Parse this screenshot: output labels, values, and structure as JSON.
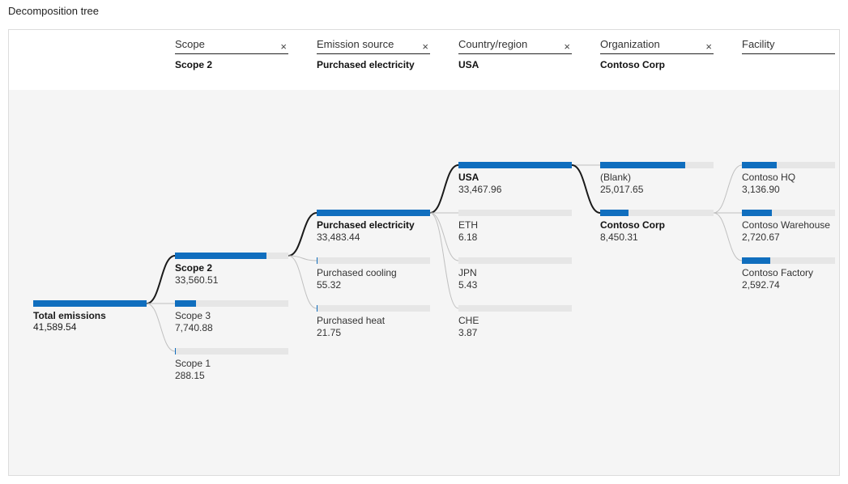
{
  "title": "Decomposition tree",
  "columns": [
    {
      "label": "Scope",
      "selected": "Scope 2",
      "closable": true
    },
    {
      "label": "Emission source",
      "selected": "Purchased electricity",
      "closable": true
    },
    {
      "label": "Country/region",
      "selected": "USA",
      "closable": true
    },
    {
      "label": "Organization",
      "selected": "Contoso Corp",
      "closable": true
    },
    {
      "label": "Facility",
      "selected": "",
      "closable": false
    }
  ],
  "root": {
    "name": "Total emissions",
    "value": "41,589.54"
  },
  "levels": {
    "scope": {
      "max": 41589.54,
      "nodes": [
        {
          "name": "Scope 2",
          "value": "33,560.51",
          "num": 33560.51,
          "selected": true
        },
        {
          "name": "Scope 3",
          "value": "7,740.88",
          "num": 7740.88,
          "selected": false
        },
        {
          "name": "Scope 1",
          "value": "288.15",
          "num": 288.15,
          "selected": false
        }
      ]
    },
    "source": {
      "max": 33560.51,
      "nodes": [
        {
          "name": "Purchased electricity",
          "value": "33,483.44",
          "num": 33483.44,
          "selected": true
        },
        {
          "name": "Purchased cooling",
          "value": "55.32",
          "num": 55.32,
          "selected": false
        },
        {
          "name": "Purchased heat",
          "value": "21.75",
          "num": 21.75,
          "selected": false
        }
      ]
    },
    "country": {
      "max": 33483.44,
      "nodes": [
        {
          "name": "USA",
          "value": "33,467.96",
          "num": 33467.96,
          "selected": true
        },
        {
          "name": "ETH",
          "value": "6.18",
          "num": 6.18,
          "selected": false
        },
        {
          "name": "JPN",
          "value": "5.43",
          "num": 5.43,
          "selected": false
        },
        {
          "name": "CHE",
          "value": "3.87",
          "num": 3.87,
          "selected": false
        }
      ]
    },
    "org": {
      "max": 33467.96,
      "nodes": [
        {
          "name": "(Blank)",
          "value": "25,017.65",
          "num": 25017.65,
          "selected": false
        },
        {
          "name": "Contoso Corp",
          "value": "8,450.31",
          "num": 8450.31,
          "selected": true
        }
      ]
    },
    "facility": {
      "max": 8450.31,
      "nodes": [
        {
          "name": "Contoso HQ",
          "value": "3,136.90",
          "num": 3136.9,
          "selected": false
        },
        {
          "name": "Contoso Warehouse",
          "value": "2,720.67",
          "num": 2720.67,
          "selected": false
        },
        {
          "name": "Contoso Factory",
          "value": "2,592.74",
          "num": 2592.74,
          "selected": false
        }
      ]
    }
  },
  "chart_data": {
    "type": "tree",
    "title": "Decomposition tree",
    "root": {
      "name": "Total emissions",
      "value": 41589.54
    },
    "levels": [
      {
        "dimension": "Scope",
        "selected": "Scope 2",
        "nodes": [
          {
            "name": "Scope 2",
            "value": 33560.51
          },
          {
            "name": "Scope 3",
            "value": 7740.88
          },
          {
            "name": "Scope 1",
            "value": 288.15
          }
        ]
      },
      {
        "dimension": "Emission source",
        "selected": "Purchased electricity",
        "nodes": [
          {
            "name": "Purchased electricity",
            "value": 33483.44
          },
          {
            "name": "Purchased cooling",
            "value": 55.32
          },
          {
            "name": "Purchased heat",
            "value": 21.75
          }
        ]
      },
      {
        "dimension": "Country/region",
        "selected": "USA",
        "nodes": [
          {
            "name": "USA",
            "value": 33467.96
          },
          {
            "name": "ETH",
            "value": 6.18
          },
          {
            "name": "JPN",
            "value": 5.43
          },
          {
            "name": "CHE",
            "value": 3.87
          }
        ]
      },
      {
        "dimension": "Organization",
        "selected": "Contoso Corp",
        "nodes": [
          {
            "name": "(Blank)",
            "value": 25017.65
          },
          {
            "name": "Contoso Corp",
            "value": 8450.31
          }
        ]
      },
      {
        "dimension": "Facility",
        "selected": null,
        "nodes": [
          {
            "name": "Contoso HQ",
            "value": 3136.9
          },
          {
            "name": "Contoso Warehouse",
            "value": 2720.67
          },
          {
            "name": "Contoso Factory",
            "value": 2592.74
          }
        ]
      }
    ]
  }
}
